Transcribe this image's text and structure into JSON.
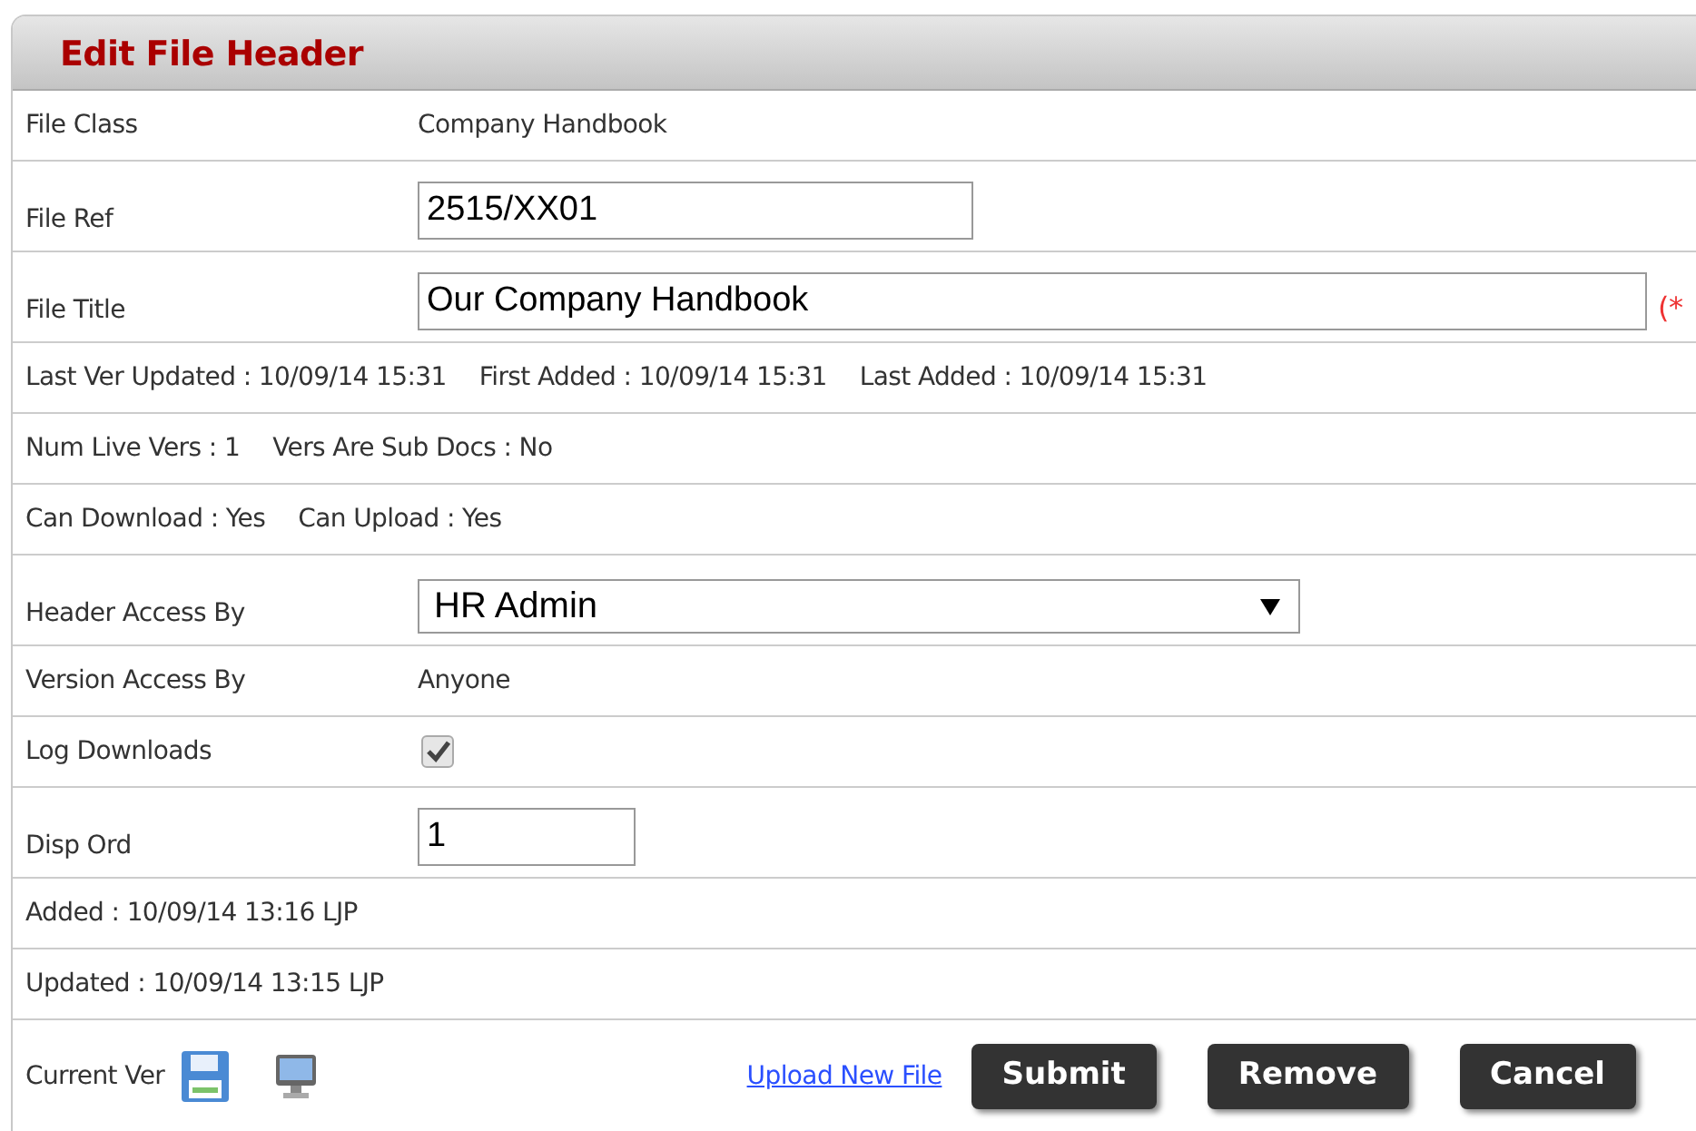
{
  "panel": {
    "title": "Edit File Header"
  },
  "rows": [
    {
      "kind": "static",
      "label": "File Class",
      "value": "Company Handbook"
    },
    {
      "kind": "input",
      "label": "File Ref",
      "value": "2515/XX01"
    },
    {
      "kind": "input",
      "label": "File Title",
      "value": "Our Company Handbook",
      "required_mark": "(*"
    },
    {
      "kind": "info",
      "items": [
        "Last Ver Updated : 10/09/14 15:31",
        "First Added : 10/09/14 15:31",
        "Last Added : 10/09/14 15:31"
      ]
    },
    {
      "kind": "info",
      "items": [
        "Num Live Vers : 1",
        "Vers Are Sub Docs : No"
      ]
    },
    {
      "kind": "info",
      "items": [
        "Can Download : Yes",
        "Can Upload : Yes"
      ]
    },
    {
      "kind": "select",
      "label": "Header Access By",
      "value": "HR Admin"
    },
    {
      "kind": "static",
      "label": "Version Access By",
      "value": "Anyone"
    },
    {
      "kind": "checkbox",
      "label": "Log Downloads",
      "checked": true
    },
    {
      "kind": "input",
      "label": "Disp Ord",
      "value": "1"
    },
    {
      "kind": "info",
      "items": [
        "Added : 10/09/14 13:16 LJP"
      ]
    },
    {
      "kind": "info",
      "items": [
        "Updated : 10/09/14 13:15 LJP"
      ]
    }
  ],
  "footer": {
    "label": "Current Ver",
    "link": "Upload New File",
    "buttons": [
      "Submit",
      "Remove",
      "Cancel"
    ]
  }
}
